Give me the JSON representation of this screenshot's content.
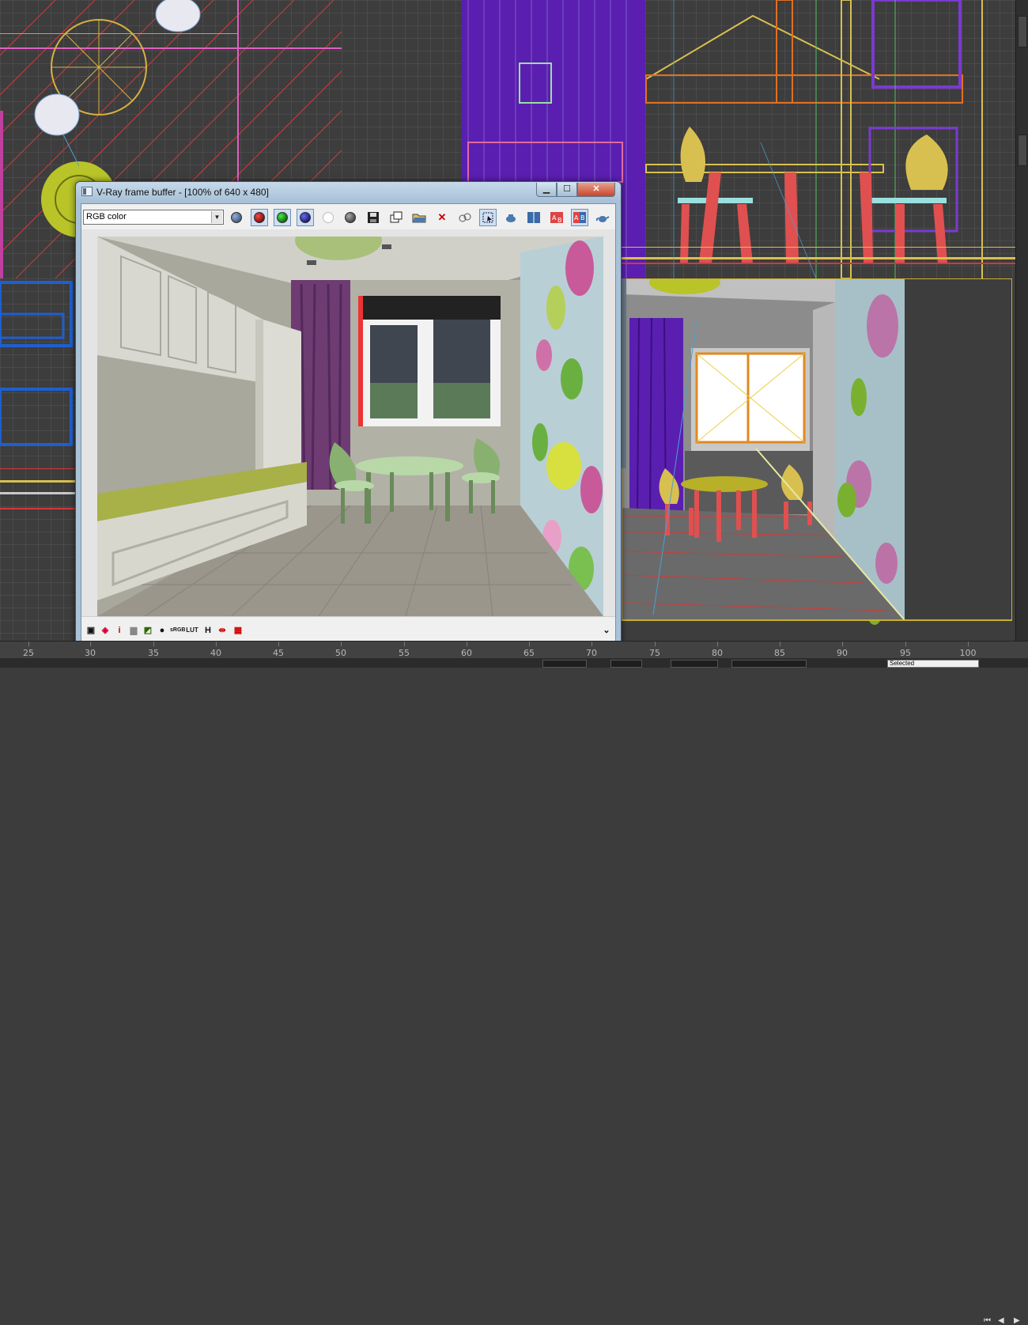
{
  "window": {
    "title": "V-Ray frame buffer - [100% of 640 x 480]",
    "minimize_label": "▁",
    "maximize_label": "☐",
    "close_label": "✕"
  },
  "toolbar": {
    "channel_value": "RGB color",
    "buttons": [
      {
        "name": "color-sphere-icon",
        "color": "#3a5d8a"
      },
      {
        "name": "red-channel-icon",
        "color": "#8b0000"
      },
      {
        "name": "green-channel-icon",
        "color": "#006400"
      },
      {
        "name": "blue-channel-icon",
        "color": "#00008b"
      },
      {
        "name": "white-sphere-icon",
        "color": "#ffffff"
      },
      {
        "name": "grey-sphere-icon",
        "color": "#555555"
      },
      {
        "name": "save-icon"
      },
      {
        "name": "clone-frame-icon"
      },
      {
        "name": "open-folder-icon"
      },
      {
        "name": "clear-icon"
      },
      {
        "name": "track-mouse-icon"
      },
      {
        "name": "region-render-icon"
      },
      {
        "name": "render-last-icon"
      },
      {
        "name": "compare-icon"
      },
      {
        "name": "ab-horizontal-icon"
      },
      {
        "name": "ab-vertical-icon"
      },
      {
        "name": "teapot-render-icon"
      }
    ]
  },
  "bottom_toolbar": {
    "items": [
      {
        "name": "display-correction-icon",
        "glyph": "▣"
      },
      {
        "name": "color-balance-icon",
        "glyph": "◈"
      },
      {
        "name": "info-icon",
        "glyph": "i"
      },
      {
        "name": "levels-icon",
        "glyph": "▆"
      },
      {
        "name": "curves-icon",
        "glyph": "◩"
      },
      {
        "name": "exposure-icon",
        "glyph": "●"
      },
      {
        "name": "srgb-icon",
        "glyph": "sRGB"
      },
      {
        "name": "lut-icon",
        "glyph": "LUT"
      },
      {
        "name": "history-icon",
        "glyph": "H"
      },
      {
        "name": "stereo-icon",
        "glyph": "⇹"
      },
      {
        "name": "pixel-aspect-icon",
        "glyph": "▦"
      }
    ],
    "expand_glyph": "⌄"
  },
  "timeline": {
    "ticks": [
      "25",
      "30",
      "35",
      "40",
      "45",
      "50",
      "55",
      "60",
      "65",
      "70",
      "75",
      "80",
      "85",
      "90",
      "95",
      "100"
    ]
  },
  "statusbar": {
    "selection_value": "Selected"
  },
  "colors": {
    "viewport_bg": "#3d3d3d",
    "grid": "#555555",
    "active_border": "#c8b02a",
    "purple_curtain": "#5a1fb0",
    "chair_red": "#e05050",
    "table_yellow": "#d8c050"
  }
}
